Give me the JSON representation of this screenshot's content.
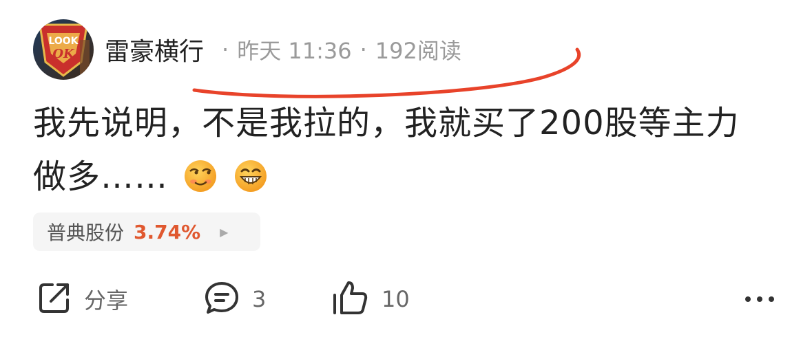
{
  "post": {
    "author": "雷豪横行",
    "time": "昨天 11:36",
    "separator": "·",
    "reads": "192阅读",
    "avatar_text_top": "LOOK",
    "avatar_text_bottom": "OK",
    "content_line1": "我先说明，不是我拉的，我就买了200股等主力",
    "content_line2": "做多……",
    "emojis": [
      "sly-smile-emoji",
      "grin-emoji"
    ]
  },
  "stock": {
    "name": "普典股份",
    "change": "3.74%",
    "arrow": "▶",
    "change_color": "#e0582f"
  },
  "actions": {
    "share_label": "分享",
    "comment_count": "3",
    "like_count": "10",
    "more_icon": "more-dots-icon"
  },
  "colors": {
    "annotation_red": "#e8432a",
    "meta_gray": "#9a9a9a"
  }
}
